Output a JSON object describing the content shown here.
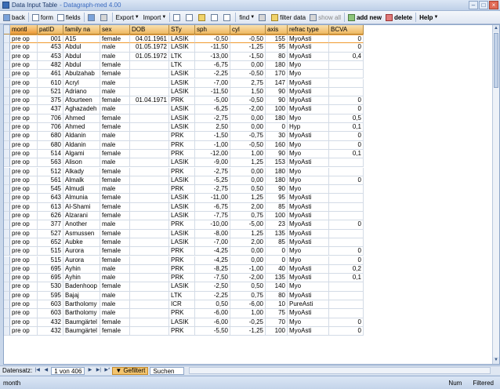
{
  "window": {
    "title": "Data Input Table",
    "subtitle": "- Datagraph-med 4.00"
  },
  "toolbar": {
    "back": "back",
    "form": "form",
    "fields": "fields",
    "export": "Export",
    "import": "Import",
    "find": "find",
    "filter_data": "filter data",
    "show_all": "show all",
    "add_new": "add new",
    "delete": "delete",
    "help": "Help"
  },
  "columns": [
    "montl",
    "patID",
    "family na",
    "sex",
    "DOB",
    "STy",
    "sph",
    "cyl",
    "axis",
    "refrac type",
    "BCVA"
  ],
  "rows": [
    [
      "pre op",
      "001",
      "A15",
      "female",
      "04.01.1961",
      "LASIK",
      "-0,50",
      "-0,50",
      "155",
      "MyoAsti",
      "0"
    ],
    [
      "pre op",
      "453",
      "Abdul",
      "male",
      "01.05.1972",
      "LASIK",
      "-11,50",
      "-1,25",
      "95",
      "MyoAsti",
      "0"
    ],
    [
      "pre op",
      "453",
      "Abdul",
      "male",
      "01.05.1972",
      "LTK",
      "-13,00",
      "-1,50",
      "80",
      "MyoAsti",
      "0,4"
    ],
    [
      "pre op",
      "482",
      "Abdul",
      "female",
      "",
      "LTK",
      "-6,75",
      "0,00",
      "180",
      "Myo",
      ""
    ],
    [
      "pre op",
      "461",
      "Abulzahab",
      "female",
      "",
      "LASIK",
      "-2,25",
      "-0,50",
      "170",
      "Myo",
      ""
    ],
    [
      "pre op",
      "610",
      "Acryl",
      "male",
      "",
      "LASIK",
      "-7,00",
      "2,75",
      "147",
      "MyoAsti",
      ""
    ],
    [
      "pre op",
      "521",
      "Adriano",
      "male",
      "",
      "LASIK",
      "-11,50",
      "1,50",
      "90",
      "MyoAsti",
      ""
    ],
    [
      "pre op",
      "375",
      "Afourteen",
      "female",
      "01.04.1971",
      "PRK",
      "-5,00",
      "-0,50",
      "90",
      "MyoAsti",
      "0"
    ],
    [
      "pre op",
      "437",
      "Aghazadeh",
      "male",
      "",
      "LASIK",
      "-6,25",
      "-2,00",
      "100",
      "MyoAsti",
      "0"
    ],
    [
      "pre op",
      "706",
      "Ahmed",
      "female",
      "",
      "LASIK",
      "-2,75",
      "0,00",
      "180",
      "Myo",
      "0,5"
    ],
    [
      "pre op",
      "706",
      "Ahmed",
      "female",
      "",
      "LASIK",
      "2,50",
      "0,00",
      "0",
      "Hyp",
      "0,1"
    ],
    [
      "pre op",
      "680",
      "Aldanin",
      "male",
      "",
      "PRK",
      "-1,50",
      "-0,75",
      "30",
      "MyoAsti",
      "0"
    ],
    [
      "pre op",
      "680",
      "Aldanin",
      "male",
      "",
      "PRK",
      "-1,00",
      "-0,50",
      "160",
      "Myo",
      "0"
    ],
    [
      "pre op",
      "514",
      "Algami",
      "female",
      "",
      "PRK",
      "-12,00",
      "1,00",
      "90",
      "Myo",
      "0,1"
    ],
    [
      "pre op",
      "563",
      "Alison",
      "male",
      "",
      "LASIK",
      "-9,00",
      "1,25",
      "153",
      "MyoAsti",
      ""
    ],
    [
      "pre op",
      "512",
      "Alkady",
      "female",
      "",
      "PRK",
      "-2,75",
      "0,00",
      "180",
      "Myo",
      ""
    ],
    [
      "pre op",
      "561",
      "Almalk",
      "female",
      "",
      "LASIK",
      "-5,25",
      "0,00",
      "180",
      "Myo",
      "0"
    ],
    [
      "pre op",
      "545",
      "Almudi",
      "male",
      "",
      "PRK",
      "-2,75",
      "0,50",
      "90",
      "Myo",
      ""
    ],
    [
      "pre op",
      "643",
      "Almunia",
      "female",
      "",
      "LASIK",
      "-11,00",
      "1,25",
      "95",
      "MyoAsti",
      ""
    ],
    [
      "pre op",
      "613",
      "Al-Shami",
      "female",
      "",
      "LASIK",
      "-6,75",
      "2,00",
      "85",
      "MyoAsti",
      ""
    ],
    [
      "pre op",
      "626",
      "Alzarani",
      "female",
      "",
      "LASIK",
      "-7,75",
      "0,75",
      "100",
      "MyoAsti",
      ""
    ],
    [
      "pre op",
      "377",
      "Another",
      "male",
      "",
      "PRK",
      "-10,00",
      "-5,00",
      "23",
      "MyoAsti",
      "0"
    ],
    [
      "pre op",
      "527",
      "Asmussen",
      "female",
      "",
      "LASIK",
      "-8,00",
      "1,25",
      "135",
      "MyoAsti",
      ""
    ],
    [
      "pre op",
      "652",
      "Aubke",
      "female",
      "",
      "LASIK",
      "-7,00",
      "2,00",
      "85",
      "MyoAsti",
      ""
    ],
    [
      "pre op",
      "515",
      "Aurora",
      "female",
      "",
      "PRK",
      "-4,25",
      "0,00",
      "0",
      "Myo",
      "0"
    ],
    [
      "pre op",
      "515",
      "Aurora",
      "female",
      "",
      "PRK",
      "-4,25",
      "0,00",
      "0",
      "Myo",
      "0"
    ],
    [
      "pre op",
      "695",
      "Ayhin",
      "male",
      "",
      "PRK",
      "-8,25",
      "-1,00",
      "40",
      "MyoAsti",
      "0,2"
    ],
    [
      "pre op",
      "695",
      "Ayhin",
      "male",
      "",
      "PRK",
      "-7,50",
      "-2,00",
      "135",
      "MyoAsti",
      "0,1"
    ],
    [
      "pre op",
      "530",
      "Badenhoop",
      "female",
      "",
      "LASIK",
      "-2,50",
      "0,50",
      "140",
      "Myo",
      ""
    ],
    [
      "pre op",
      "595",
      "Bajaj",
      "male",
      "",
      "LTK",
      "-2,25",
      "0,75",
      "80",
      "MyoAsti",
      ""
    ],
    [
      "pre op",
      "603",
      "Bartholomy",
      "male",
      "",
      "ICR",
      "0,50",
      "-6,00",
      "10",
      "PureAsti",
      ""
    ],
    [
      "pre op",
      "603",
      "Bartholomy",
      "male",
      "",
      "PRK",
      "-6,00",
      "1,00",
      "75",
      "MyoAsti",
      ""
    ],
    [
      "pre op",
      "432",
      "Baumgärtel",
      "female",
      "",
      "LASIK",
      "-6,00",
      "-0,25",
      "70",
      "Myo",
      "0"
    ],
    [
      "pre op",
      "432",
      "Baumgärtel",
      "female",
      "",
      "PRK",
      "-5,50",
      "-1,25",
      "100",
      "MyoAsti",
      "0"
    ]
  ],
  "navigation": {
    "label": "Datensatz:",
    "position": "1 von 406",
    "filter": "Gefiltert",
    "search": "Suchen"
  },
  "status": {
    "left": "month",
    "num": "Num",
    "filtered": "Filtered"
  }
}
